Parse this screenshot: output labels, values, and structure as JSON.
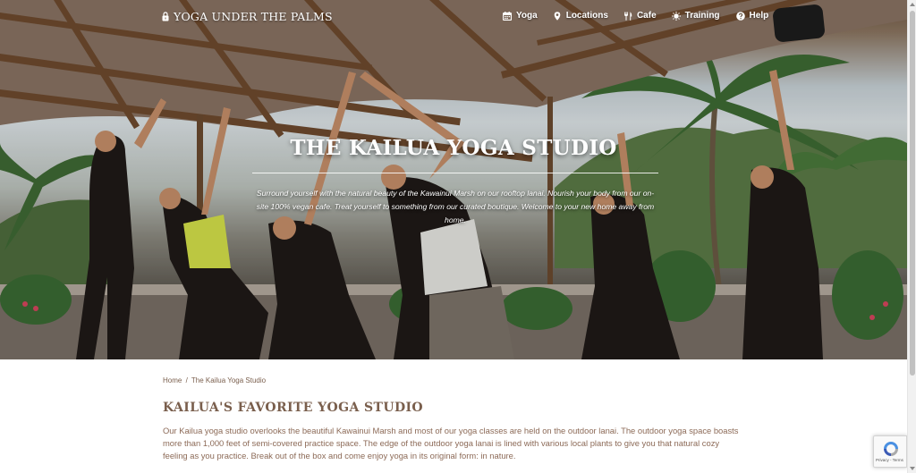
{
  "brand": {
    "name": "YOGA UNDER THE PALMS",
    "icon": "lock-icon"
  },
  "nav": {
    "items": [
      {
        "label": "Yoga",
        "icon": "calendar-icon"
      },
      {
        "label": "Locations",
        "icon": "map-pin-icon"
      },
      {
        "label": "Cafe",
        "icon": "utensils-icon"
      },
      {
        "label": "Training",
        "icon": "sun-icon"
      },
      {
        "label": "Help",
        "icon": "question-circle-icon"
      }
    ]
  },
  "hero": {
    "title": "THE KAILUA YOGA STUDIO",
    "description": "Surround yourself with the natural beauty of the Kawainui Marsh on our rooftop lanai. Nourish your body from our on-site 100% vegan cafe. Treat yourself to something from our curated boutique. Welcome to your new home away from home."
  },
  "breadcrumb": {
    "home": "Home",
    "separator": "/",
    "current": "The Kailua Yoga Studio"
  },
  "section": {
    "heading": "KAILUA'S FAVORITE YOGA STUDIO",
    "body": "Our Kailua yoga studio overlooks the beautiful Kawainui Marsh and most of our yoga classes are held on the outdoor lanai. The outdoor yoga space boasts more than 1,000 feet of semi-covered practice space. The edge of the outdoor yoga lanai is lined with various local plants to give you that natural cozy feeling as you practice. Break out of the box and come enjoy yoga in its original form: in nature."
  },
  "recaptcha": {
    "links": "Privacy - Terms"
  },
  "colors": {
    "text_brown": "#7a5f4d",
    "body_brown": "#8c6a57",
    "hero_text": "#ffffff"
  }
}
